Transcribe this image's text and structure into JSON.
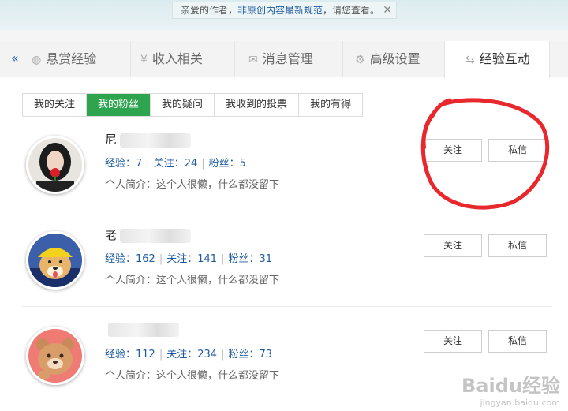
{
  "notice": {
    "prefix": "亲爱的作者，",
    "link": "非原创内容最新规范",
    "suffix": "，请您查看。"
  },
  "tabs": [
    {
      "label": "悬赏经验"
    },
    {
      "label": "收入相关"
    },
    {
      "label": "消息管理"
    },
    {
      "label": "高级设置"
    },
    {
      "label": "经验互动",
      "active": true
    }
  ],
  "subtabs": [
    {
      "label": "我的关注"
    },
    {
      "label": "我的粉丝",
      "active": true
    },
    {
      "label": "我的疑问"
    },
    {
      "label": "我收到的投票"
    },
    {
      "label": "我的有得"
    }
  ],
  "labels": {
    "exp": "经验：",
    "follow": "关注：",
    "fans": "粉丝：",
    "follow_btn": "关注",
    "msg_btn": "私信"
  },
  "users": [
    {
      "name": "尼",
      "exp": "7",
      "follow": "24",
      "fans": "5",
      "bio": "个人简介：这个人很懒，什么都没留下"
    },
    {
      "name": "老",
      "exp": "162",
      "follow": "141",
      "fans": "31",
      "bio": "个人简介：这个人很懒，什么都没留下"
    },
    {
      "name": "",
      "exp": "112",
      "follow": "234",
      "fans": "73",
      "bio": "个人简介：这个人很懒，什么都没留下"
    }
  ],
  "watermark": {
    "main": "Baidu经验",
    "url": "jingyan.baidu.com"
  },
  "colors": {
    "accent_green": "#2ea44f",
    "link_blue": "#1d5a9e",
    "annotation_red": "#e8282c"
  }
}
